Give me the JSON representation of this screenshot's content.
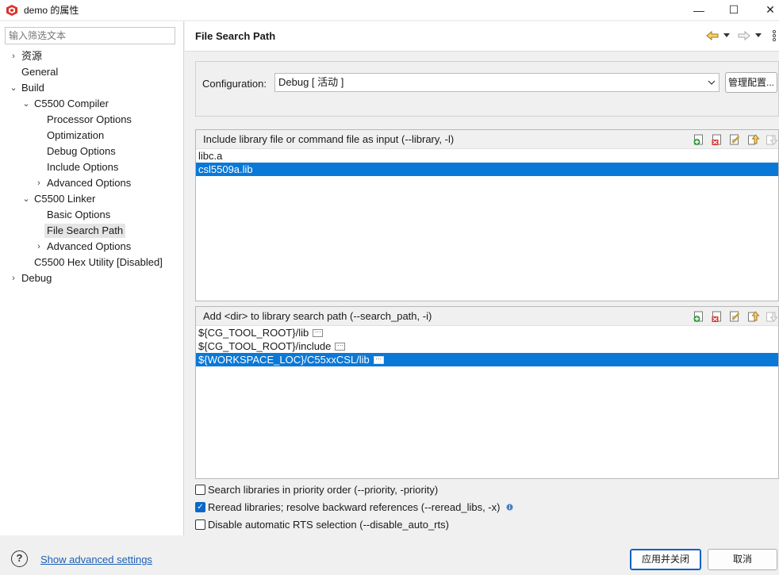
{
  "window": {
    "title": "demo 的属性",
    "minimize_label": "—",
    "maximize_label": "☐",
    "close_label": "✕"
  },
  "sidebar": {
    "filter_placeholder": "输入筛选文本",
    "items": [
      {
        "label": "资源",
        "chevron": "›"
      },
      {
        "label": "General",
        "chevron": ""
      },
      {
        "label": "Build",
        "chevron": "⌄"
      },
      {
        "label": "C5500 Compiler",
        "chevron": "⌄"
      },
      {
        "label": "Processor Options",
        "chevron": ""
      },
      {
        "label": "Optimization",
        "chevron": ""
      },
      {
        "label": "Debug Options",
        "chevron": ""
      },
      {
        "label": "Include Options",
        "chevron": ""
      },
      {
        "label": "Advanced Options",
        "chevron": "›"
      },
      {
        "label": "C5500 Linker",
        "chevron": "⌄"
      },
      {
        "label": "Basic Options",
        "chevron": ""
      },
      {
        "label": "File Search Path",
        "chevron": ""
      },
      {
        "label": "Advanced Options",
        "chevron": "›"
      },
      {
        "label": "C5500 Hex Utility  [Disabled]",
        "chevron": ""
      },
      {
        "label": "Debug",
        "chevron": "›"
      }
    ]
  },
  "header": {
    "title": "File Search Path"
  },
  "configuration": {
    "label": "Configuration:",
    "value": "Debug  [ 活动 ]",
    "manage_button": "管理配置..."
  },
  "library_panel": {
    "header": "Include library file or command file as input (--library, -l)",
    "rows": [
      "libc.a",
      "csl5509a.lib"
    ],
    "selected_index": 1
  },
  "search_path_panel": {
    "header": "Add <dir> to library search path (--search_path, -i)",
    "rows": [
      "${CG_TOOL_ROOT}/lib",
      "${CG_TOOL_ROOT}/include",
      "${WORKSPACE_LOC}/C55xxCSL/lib"
    ],
    "selected_index": 2
  },
  "options": {
    "priority": {
      "label": "Search libraries in priority order (--priority, -priority)",
      "checked": false
    },
    "reread": {
      "label": "Reread libraries; resolve backward references (--reread_libs, -x)",
      "checked": true
    },
    "rts": {
      "label": "Disable automatic RTS selection (--disable_auto_rts)",
      "checked": false
    }
  },
  "footer": {
    "help_glyph": "?",
    "advanced_link": "Show advanced settings",
    "apply_close": "应用并关闭",
    "cancel": "取消"
  },
  "colors": {
    "selection": "#0a78d7",
    "link": "#1a5fb4"
  }
}
